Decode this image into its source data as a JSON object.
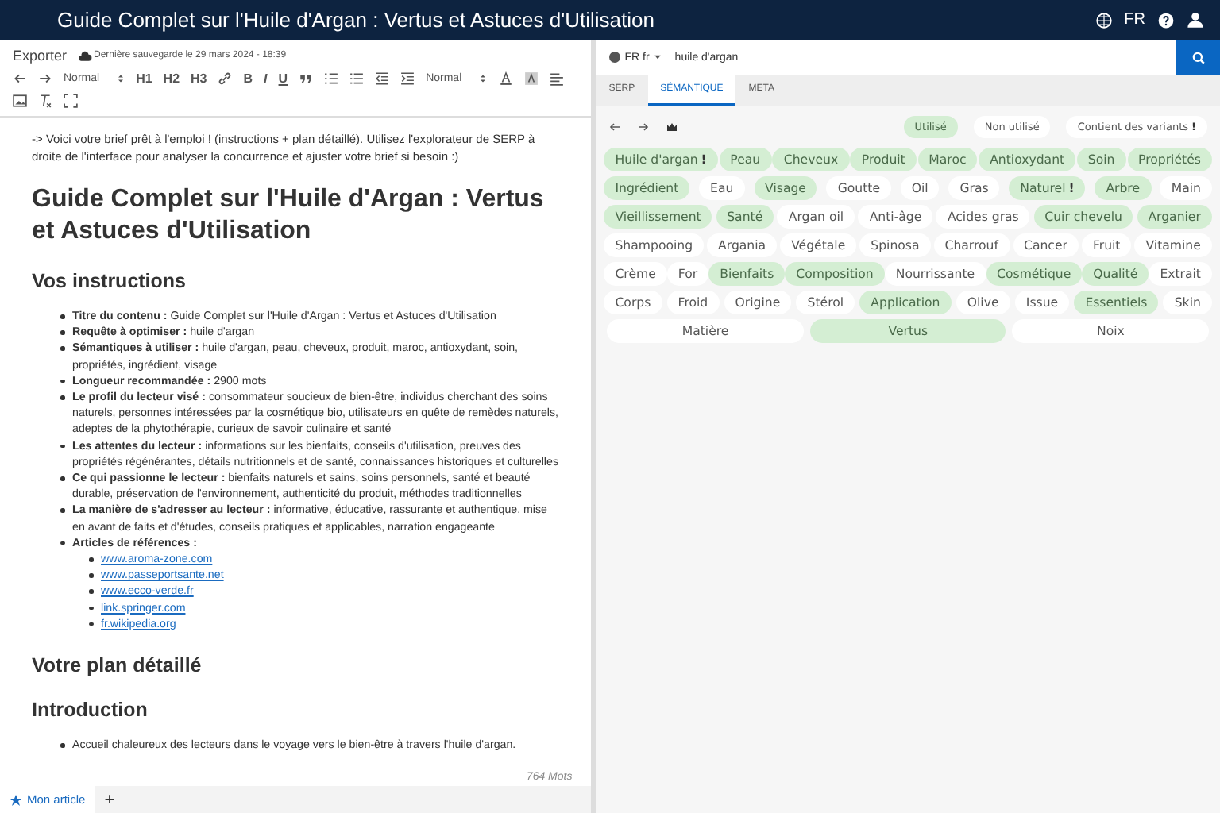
{
  "header": {
    "title": "Guide Complet sur l'Huile d'Argan : Vertus et Astuces d'Utilisation",
    "language": "FR"
  },
  "editor": {
    "menu": "Exporter",
    "saved": "Dernière sauvegarde le 29 mars 2024 - 18:39",
    "toolbar": {
      "format_select": "Normal",
      "headings": [
        "H1",
        "H2",
        "H3"
      ],
      "marks": [
        "B",
        "I",
        "U"
      ],
      "size_select": "Normal"
    },
    "intro": "-> Voici votre brief prêt à l'emploi ! (instructions + plan détaillé). Utilisez l'explorateur de SERP à droite de l'interface pour analyser la concurrence et ajuster votre brief si besoin :)",
    "title": "Guide Complet sur l'Huile d'Argan : Vertus et Astuces d'Utilisation",
    "instructions_heading": "Vos instructions",
    "instructions": [
      {
        "label": "Titre du contenu :",
        "text": "Guide Complet sur l'Huile d'Argan : Vertus et Astuces d'Utilisation"
      },
      {
        "label": "Requête à optimiser :",
        "text": "huile d'argan"
      },
      {
        "label": "Sémantiques à utiliser :",
        "text": "huile d'argan, peau, cheveux, produit, maroc, antioxydant, soin, propriétés, ingrédient, visage"
      },
      {
        "label": "Longueur recommandée :",
        "text": "2900 mots"
      },
      {
        "label": "Le profil du lecteur visé :",
        "text": "consommateur soucieux de bien-être, individus cherchant des soins naturels, personnes intéressées par la cosmétique bio, utilisateurs en quête de remèdes naturels, adeptes de la phytothérapie, curieux de savoir culinaire et santé"
      },
      {
        "label": "Les attentes du lecteur :",
        "text": "informations sur les bienfaits, conseils d'utilisation, preuves des propriétés régénérantes, détails nutritionnels et de santé, connaissances historiques et culturelles"
      },
      {
        "label": "Ce qui passionne le lecteur :",
        "text": "bienfaits naturels et sains, soins personnels, santé et beauté durable, préservation de l'environnement, authenticité du produit, méthodes traditionnelles"
      },
      {
        "label": "La manière de s'adresser au lecteur :",
        "text": "informative, éducative, rassurante et authentique, mise en avant de faits et d'études, conseils pratiques et applicables, narration engageante"
      },
      {
        "label": "Articles de références :"
      }
    ],
    "references": [
      "www.aroma-zone.com",
      "www.passeportsante.net",
      "www.ecco-verde.fr",
      "link.springer.com",
      "fr.wikipedia.org"
    ],
    "plan_heading": "Votre plan détaillé",
    "intro_heading": "Introduction",
    "intro_items": [
      "Accueil chaleureux des lecteurs dans le voyage vers le bien-être à travers l'huile d'argan."
    ],
    "word_count": "764 Mots",
    "tabs": [
      {
        "label": "Mon article",
        "selected": true
      }
    ],
    "add_tab": "+"
  },
  "explorer": {
    "locale": "FR fr",
    "query": "huile d'argan",
    "tabs": [
      {
        "label": "SERP",
        "selected": false
      },
      {
        "label": "SÉMANTIQUE",
        "selected": true
      },
      {
        "label": "META",
        "selected": false
      }
    ],
    "filters": [
      {
        "label": "Utilisé",
        "used": true
      },
      {
        "label": "Non utilisé",
        "used": false
      },
      {
        "label": "Contient des variants",
        "used": false,
        "badge": "!"
      }
    ],
    "keyword_rows": [
      [
        {
          "label": "Huile d'argan",
          "used": true,
          "badge": "!"
        },
        {
          "label": "Peau",
          "used": true
        },
        {
          "label": "Cheveux",
          "used": true
        },
        {
          "label": "Produit",
          "used": true
        },
        {
          "label": "Maroc",
          "used": true
        },
        {
          "label": "Antioxydant",
          "used": true
        },
        {
          "label": "Soin",
          "used": true
        },
        {
          "label": "Propriétés",
          "used": true
        }
      ],
      [
        {
          "label": "Ingrédient",
          "used": true
        },
        {
          "label": "Eau",
          "used": false
        },
        {
          "label": "Visage",
          "used": true
        },
        {
          "label": "Goutte",
          "used": false
        },
        {
          "label": "Oil",
          "used": false
        },
        {
          "label": "Gras",
          "used": false
        },
        {
          "label": "Naturel",
          "used": true,
          "badge": "!"
        },
        {
          "label": "Arbre",
          "used": true
        },
        {
          "label": "Main",
          "used": false
        }
      ],
      [
        {
          "label": "Vieillissement",
          "used": true
        },
        {
          "label": "Santé",
          "used": true
        },
        {
          "label": "Argan oil",
          "used": false
        },
        {
          "label": "Anti-âge",
          "used": false
        },
        {
          "label": "Acides gras",
          "used": false
        },
        {
          "label": "Cuir chevelu",
          "used": true
        },
        {
          "label": "Arganier",
          "used": true
        }
      ],
      [
        {
          "label": "Shampooing",
          "used": false
        },
        {
          "label": "Argania",
          "used": false
        },
        {
          "label": "Végétale",
          "used": false
        },
        {
          "label": "Spinosa",
          "used": false
        },
        {
          "label": "Charrouf",
          "used": false
        },
        {
          "label": "Cancer",
          "used": false
        },
        {
          "label": "Fruit",
          "used": false
        },
        {
          "label": "Vitamine",
          "used": false
        }
      ],
      [
        {
          "label": "Crème",
          "used": false
        },
        {
          "label": "For",
          "used": false
        },
        {
          "label": "Bienfaits",
          "used": true
        },
        {
          "label": "Composition",
          "used": true
        },
        {
          "label": "Nourrissante",
          "used": false
        },
        {
          "label": "Cosmétique",
          "used": true
        },
        {
          "label": "Qualité",
          "used": true
        },
        {
          "label": "Extrait",
          "used": false
        }
      ],
      [
        {
          "label": "Corps",
          "used": false
        },
        {
          "label": "Froid",
          "used": false
        },
        {
          "label": "Origine",
          "used": false
        },
        {
          "label": "Stérol",
          "used": false
        },
        {
          "label": "Application",
          "used": true
        },
        {
          "label": "Olive",
          "used": false
        },
        {
          "label": "Issue",
          "used": false
        },
        {
          "label": "Essentiels",
          "used": true
        },
        {
          "label": "Skin",
          "used": false
        }
      ],
      [
        {
          "label": "Matière",
          "used": false
        },
        {
          "label": "Vertus",
          "used": true
        },
        {
          "label": "Noix",
          "used": false
        }
      ]
    ]
  }
}
